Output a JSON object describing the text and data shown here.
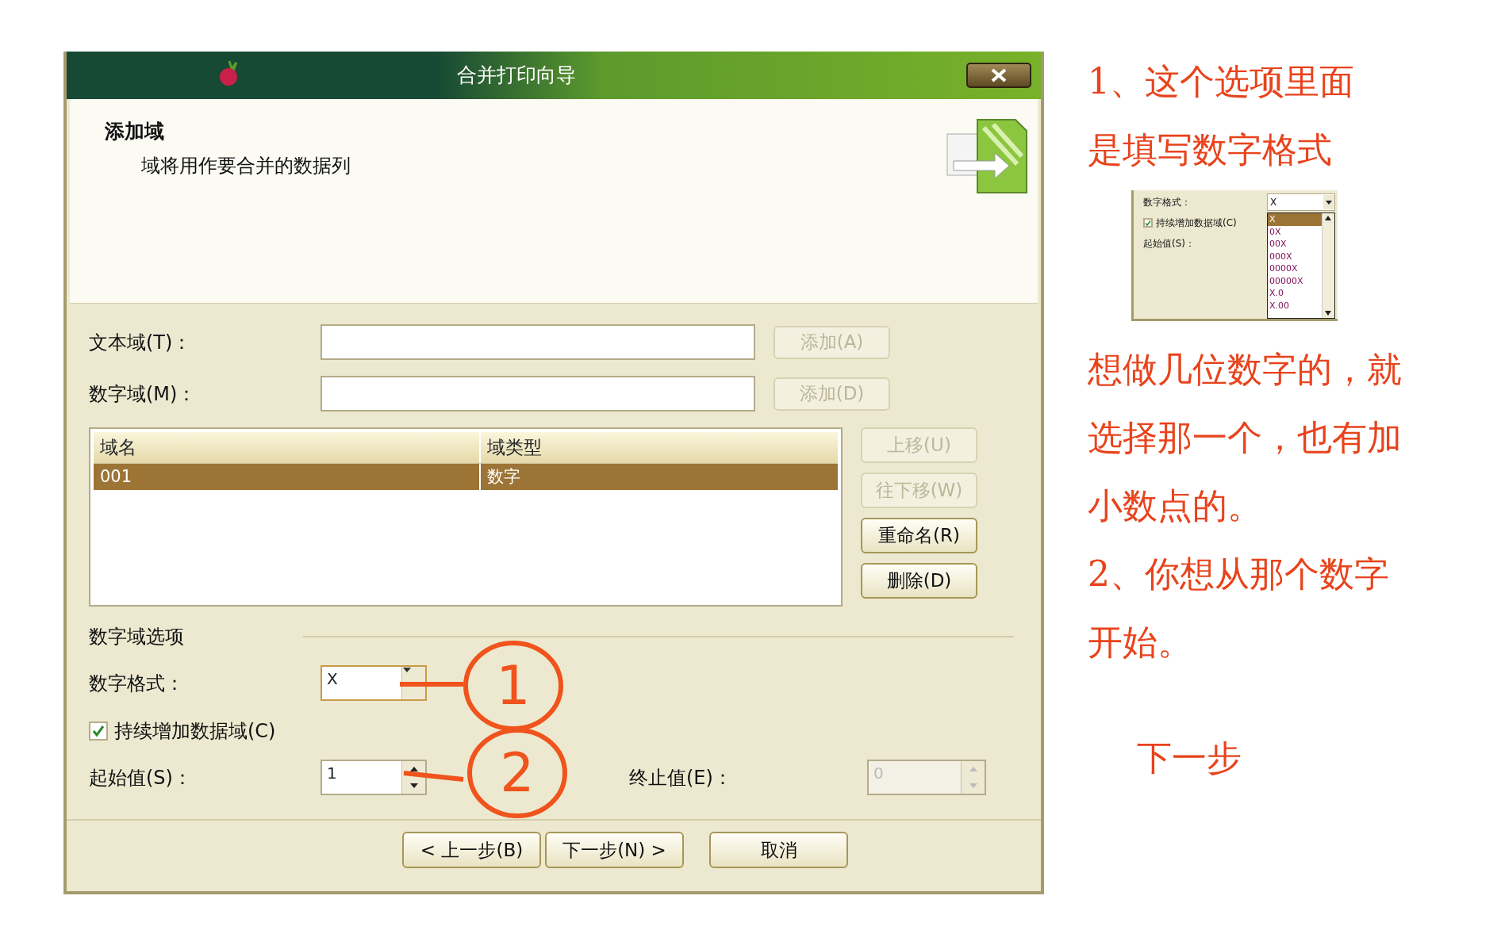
{
  "window": {
    "title": "合并打印向导"
  },
  "header": {
    "title": "添加域",
    "subtitle": "域将用作要合并的数据列"
  },
  "fields": [
    {
      "label": "文本域(T)：",
      "button": {
        "label": "添加(A)",
        "disabled": true
      }
    },
    {
      "label": "数字域(M)：",
      "button": {
        "label": "添加(D)",
        "disabled": true
      }
    }
  ],
  "field_list": {
    "columns": [
      "域名",
      "域类型"
    ],
    "rows": [
      {
        "cells": [
          "001",
          "数字"
        ],
        "selected": true
      }
    ]
  },
  "side_buttons": [
    {
      "label": "上移(U)",
      "disabled": true
    },
    {
      "label": "往下移(W)",
      "disabled": true
    },
    {
      "label": "重命名(R)",
      "disabled": false
    },
    {
      "label": "删除(D)",
      "disabled": false
    }
  ],
  "number_options": {
    "heading": "数字域选项",
    "format": {
      "label": "数字格式：",
      "value": "X"
    },
    "increment": {
      "label": "持续增加数据域(C)",
      "checked": true
    },
    "start": {
      "label": "起始值(S)：",
      "value": "1",
      "disabled": false
    },
    "end": {
      "label": "终止值(E)：",
      "value": "0",
      "disabled": true
    }
  },
  "nav_buttons": [
    {
      "label": "< 上一步(B)"
    },
    {
      "label": "下一步(N) >"
    },
    {
      "label": "取消"
    }
  ],
  "callouts": [
    {
      "number": "1"
    },
    {
      "number": "2"
    }
  ],
  "annotations": [
    {
      "kind": "text",
      "lines": [
        "1、这个选项里面",
        "是填写数字格式"
      ]
    },
    {
      "kind": "inset",
      "format_label": "数字格式：",
      "format_value": "X",
      "checkbox_label": "持续增加数据域(C)",
      "checked": true,
      "start_label": "起始值(S)：",
      "options": [
        {
          "label": "X",
          "selected": true
        },
        {
          "label": "0X",
          "selected": false
        },
        {
          "label": "00X",
          "selected": false
        },
        {
          "label": "000X",
          "selected": false
        },
        {
          "label": "0000X",
          "selected": false
        },
        {
          "label": "00000X",
          "selected": false
        },
        {
          "label": "X.0",
          "selected": false
        },
        {
          "label": "X.00",
          "selected": false
        }
      ]
    },
    {
      "kind": "text",
      "lines": [
        "想做几位数字的，就",
        "选择那一个，也有加",
        "小数点的。"
      ]
    },
    {
      "kind": "text",
      "lines": [
        "2、你想从那个数字",
        "开始。"
      ]
    },
    {
      "kind": "caption",
      "lines": [
        "下一步"
      ]
    }
  ]
}
